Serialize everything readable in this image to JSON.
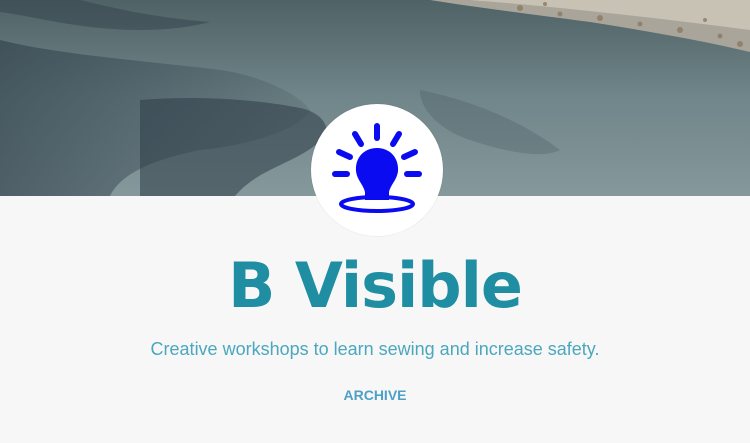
{
  "blog": {
    "title": "B Visible",
    "description": "Creative workshops to learn sewing and increase safety."
  },
  "nav": {
    "archive_label": "ARCHIVE"
  },
  "avatar": {
    "icon": "beacon-light-icon",
    "icon_color": "#0a0bf0"
  },
  "colors": {
    "title": "#1f8ea3",
    "description": "#4aa7bd",
    "link": "#4ea0c6",
    "background": "#f7f7f7"
  }
}
